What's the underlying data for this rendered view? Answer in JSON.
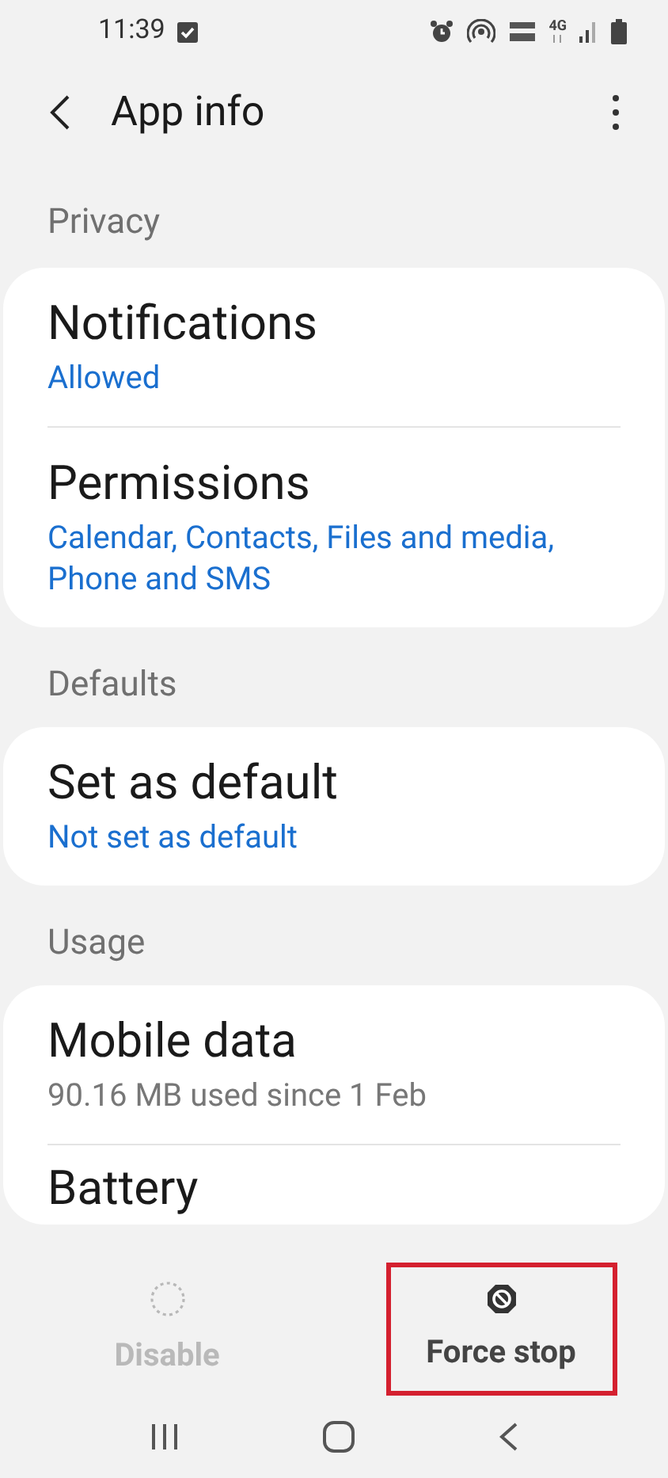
{
  "status_bar": {
    "time": "11:39",
    "network": "4G"
  },
  "header": {
    "title": "App info"
  },
  "sections": [
    {
      "label": "Privacy",
      "items": [
        {
          "title": "Notifications",
          "subtitle": "Allowed",
          "muted_subtitle": false
        },
        {
          "title": "Permissions",
          "subtitle": "Calendar, Contacts, Files and media, Phone and SMS",
          "muted_subtitle": false
        }
      ]
    },
    {
      "label": "Defaults",
      "items": [
        {
          "title": "Set as default",
          "subtitle": "Not set as default",
          "muted_subtitle": false
        }
      ]
    },
    {
      "label": "Usage",
      "items": [
        {
          "title": "Mobile data",
          "subtitle": "90.16 MB used since 1 Feb",
          "muted_subtitle": true
        },
        {
          "title": "Battery"
        }
      ]
    }
  ],
  "actions": [
    {
      "kind": "disable",
      "label": "Disable",
      "disabled": true,
      "highlighted": false
    },
    {
      "kind": "force_stop",
      "label": "Force stop",
      "disabled": false,
      "highlighted": true
    }
  ]
}
